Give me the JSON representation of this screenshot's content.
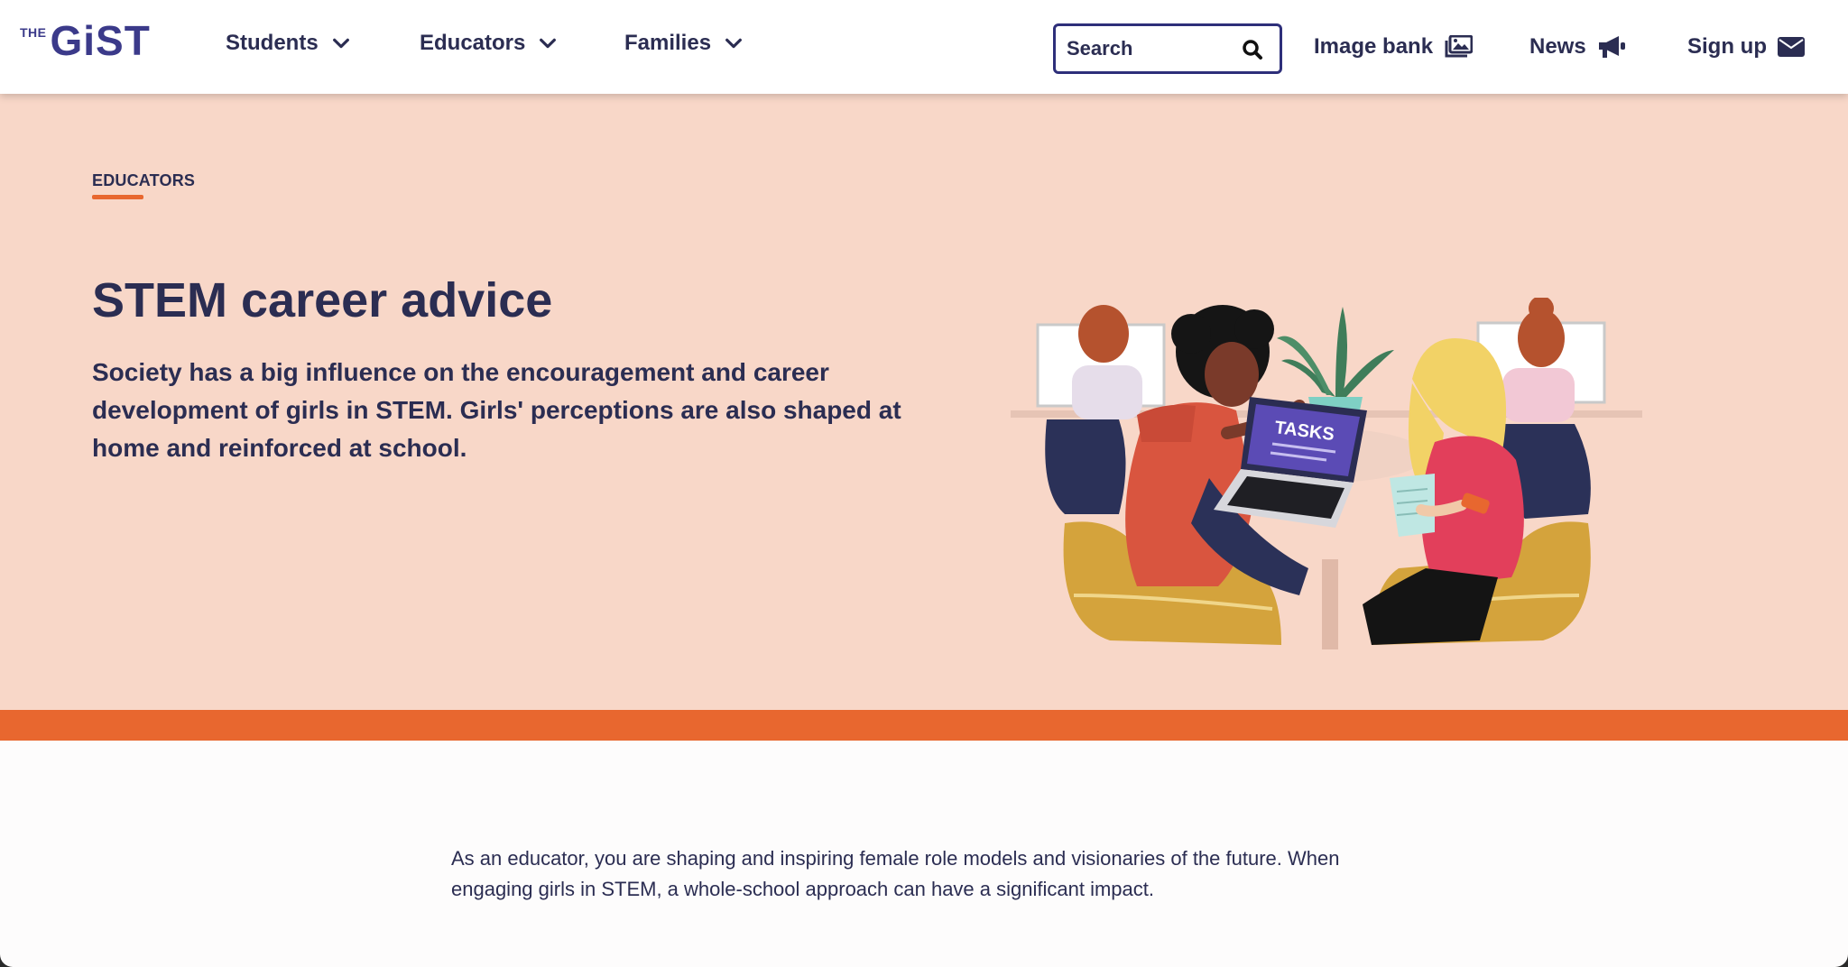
{
  "header": {
    "logo_the": "THE",
    "logo_gist": "GiST",
    "nav": [
      {
        "label": "Students"
      },
      {
        "label": "Educators"
      },
      {
        "label": "Families"
      }
    ],
    "search_placeholder": "Search",
    "image_bank": "Image bank",
    "news": "News",
    "sign_up": "Sign up"
  },
  "hero": {
    "eyebrow": "EDUCATORS",
    "title": "STEM career advice",
    "lede": "Society has a big influence on the encouragement and career development of girls in STEM. Girls' perceptions are also shaped at home and reinforced at school.",
    "illustration_screen_text": "TASKS"
  },
  "body": {
    "intro": "As an educator, you are shaping and inspiring female role models and visionaries of the future. When engaging girls in STEM, a whole-school approach can have a significant impact."
  },
  "colors": {
    "brand": "#3b3a8a",
    "text": "#2b2d52",
    "hero_bg": "#f8d7c8",
    "accent": "#e8672f"
  },
  "icons": [
    "chevron-down-icon",
    "search-icon",
    "image-bank-icon",
    "megaphone-icon",
    "envelope-icon"
  ]
}
